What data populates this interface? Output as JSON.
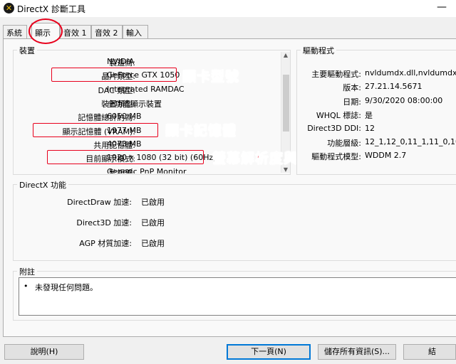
{
  "window": {
    "title": "DirectX 診斷工具",
    "minimize": "—"
  },
  "tabs": [
    "系統",
    "顯示",
    "音效 1",
    "音效 2",
    "輸入"
  ],
  "device": {
    "title": "裝置",
    "rows": [
      {
        "label": "製造商:",
        "value": "NVIDIA"
      },
      {
        "label": "晶片類型:",
        "value": "GeForce GTX 1050"
      },
      {
        "label": "DAC 類型:",
        "value": "Integrated RAMDAC"
      },
      {
        "label": "裝置類型:",
        "value": "全功能顯示裝置"
      },
      {
        "label": "記憶體總計約為:",
        "value": "6050 MB"
      },
      {
        "label": "顯示記憶體 (VRAM):",
        "value": "1977 MB"
      },
      {
        "label": "共用記憶體:",
        "value": "4073 MB"
      },
      {
        "label": "目前顯示模式:",
        "value": "1920 x 1080 (32 bit) (60Hz)"
      },
      {
        "label": "監視器:",
        "value": "Generic PnP Monitor"
      }
    ]
  },
  "drivers": {
    "title": "驅動程式",
    "rows": [
      {
        "label": "主要驅動程式:",
        "value": "nvldumdx.dll,nvldumdx.dll,nv"
      },
      {
        "label": "版本:",
        "value": "27.21.14.5671"
      },
      {
        "label": "日期:",
        "value": "9/30/2020 08:00:00"
      },
      {
        "label": "WHQL 標誌:",
        "value": "是"
      },
      {
        "label": "Direct3D DDI:",
        "value": "12"
      },
      {
        "label": "功能層級:",
        "value": "12_1,12_0,11_1,11_0,10_1,10_"
      },
      {
        "label": "驅動程式模型:",
        "value": "WDDM 2.7"
      }
    ]
  },
  "directx_features": {
    "title": "DirectX 功能",
    "rows": [
      {
        "label": "DirectDraw 加速:",
        "value": "已啟用"
      },
      {
        "label": "Direct3D 加速:",
        "value": "已啟用"
      },
      {
        "label": "AGP 材質加速:",
        "value": "已啟用"
      }
    ]
  },
  "notes": {
    "title": "附註",
    "items": [
      "未發現任何問題。"
    ]
  },
  "annotations": {
    "chip_type": "顯卡型號",
    "vram": "顯卡記憶體",
    "display_mode": "螢幕解析度與更新率"
  },
  "buttons": {
    "help": "說明(H)",
    "next_page": "下一頁(N)",
    "save_all": "儲存所有資訊(S)...",
    "exit": "結"
  },
  "colors": {
    "annotation": "#e8001c"
  }
}
